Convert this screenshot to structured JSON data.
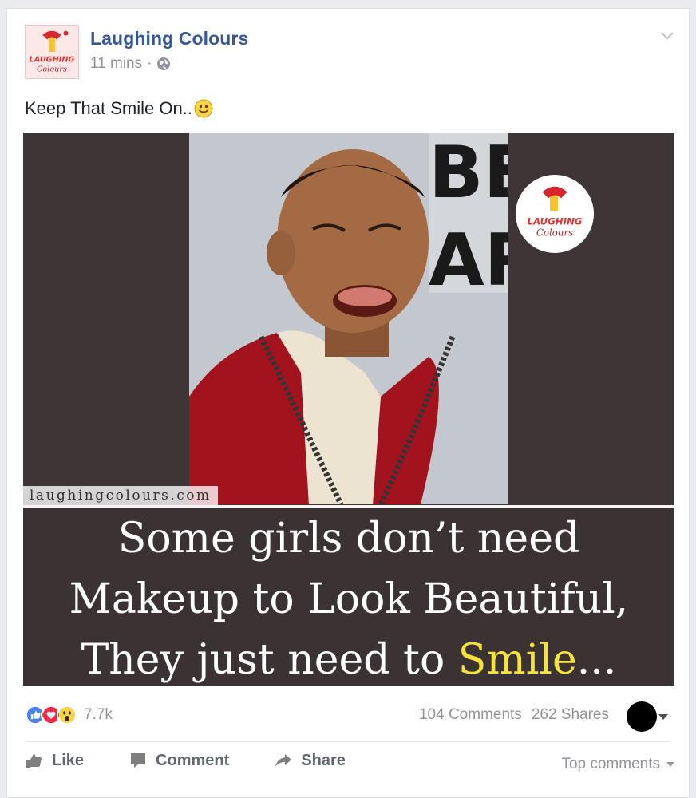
{
  "post": {
    "page_name": "Laughing Colours",
    "time": "11 mins",
    "separator": "·",
    "privacy_icon": "globe-icon",
    "menu_icon": "chevron-down-icon",
    "caption": "Keep That Smile On..",
    "caption_emoji": "smiley-icon"
  },
  "image": {
    "logo_text_1": "LAUGHING",
    "logo_text_2": "Colours",
    "watermark": "laughingcolours.com",
    "meme_lines": [
      "Some girls don’t need",
      "Makeup to Look Beautiful,",
      "They just need to "
    ],
    "meme_highlight": "Smile",
    "meme_ellipsis": "...",
    "highlight_color": "#f5e23a"
  },
  "engagement": {
    "reaction_icons": [
      "like-icon",
      "love-icon",
      "wow-icon"
    ],
    "reaction_count": "7.7k",
    "comments": "104 Comments",
    "shares": "262 Shares"
  },
  "actions": {
    "like": "Like",
    "comment": "Comment",
    "share": "Share",
    "sort": "Top comments"
  },
  "colors": {
    "link": "#365899",
    "meta": "#90949c",
    "like_blue": "#4a7ff0",
    "love_red": "#f0284a"
  }
}
